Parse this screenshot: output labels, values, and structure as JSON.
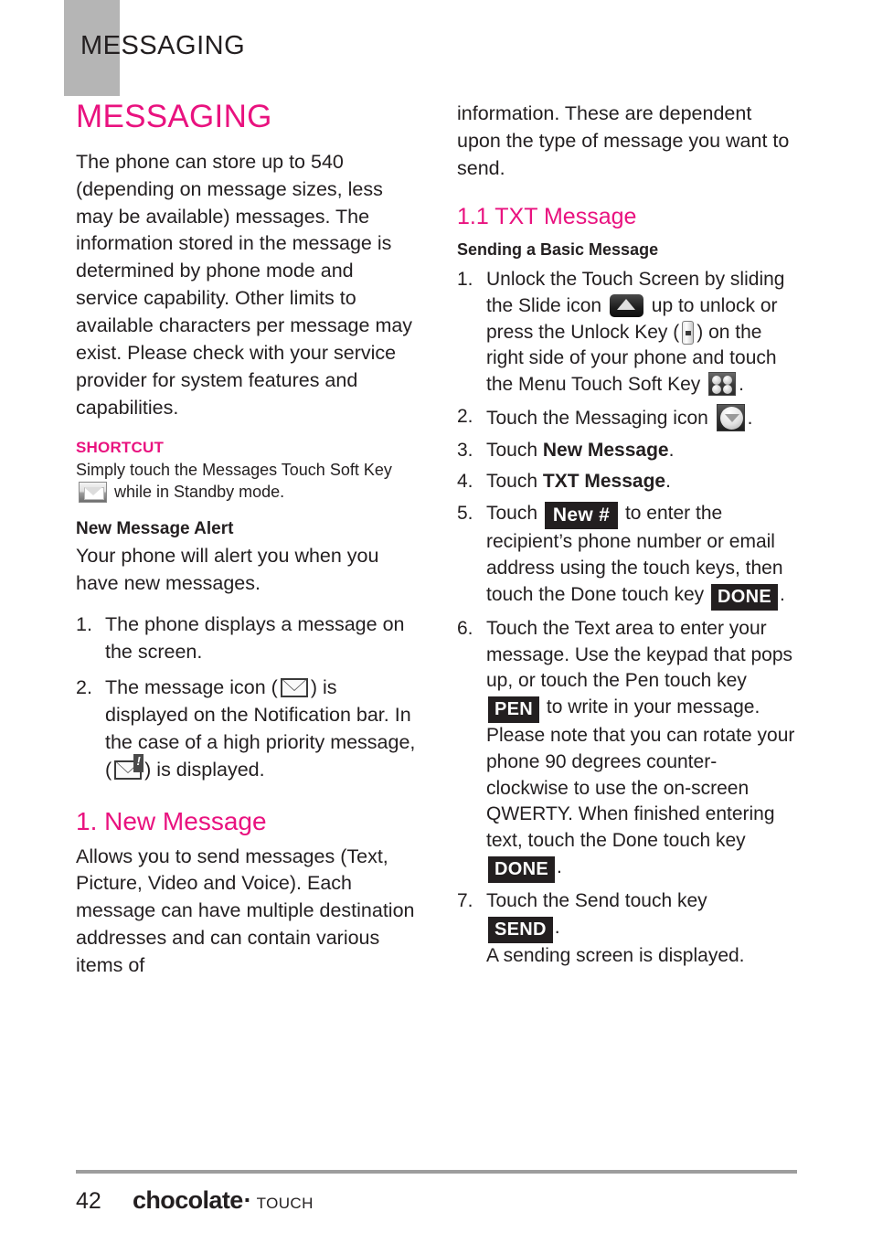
{
  "running_header": {
    "title": "MESSAGING"
  },
  "left_column": {
    "chapter_title": "MESSAGING",
    "intro_paragraph": "The phone can store up to 540 (depending on message sizes, less may be available) messages. The information stored in the message is determined by phone mode and service capability. Other limits to available characters per message may exist. Please check with your service provider for system features and capabilities.",
    "shortcut_label": "SHORTCUT",
    "shortcut_text_before": "Simply touch the Messages Touch Soft Key",
    "shortcut_icon": "messages-softkey-icon",
    "shortcut_text_after": "while in Standby mode.",
    "new_message_alert_heading": "New Message Alert",
    "new_message_alert_body": "Your phone will alert you when you have new messages.",
    "alert_steps": [
      {
        "num": "1.",
        "text": "The phone displays a message on the screen."
      },
      {
        "num": "2.",
        "text_a": "The message icon (",
        "icon_a": "envelope-icon",
        "text_b": ") is displayed on the Notification bar. In the case of a high priority message, (",
        "icon_b": "envelope-urgent-icon",
        "text_c": ") is displayed."
      }
    ],
    "section_title": "1. New Message",
    "section_body": "Allows you to send messages (Text, Picture, Video and Voice). Each message can have multiple destination addresses and can contain various items of"
  },
  "right_column": {
    "continued_paragraph": "information. These are dependent upon the type of message you want to send.",
    "subsection_title": "1.1 TXT Message",
    "subsection_heading": "Sending a Basic Message",
    "steps": [
      {
        "num": "1.",
        "text_a": "Unlock the Touch Screen by sliding the Slide icon",
        "icon_a": "slide-up-icon",
        "text_b": "up to unlock or press the Unlock Key (",
        "icon_b": "unlock-key-icon",
        "text_c": ") on the right side of your phone and touch the Menu Touch Soft Key",
        "icon_c": "menu-softkey-icon",
        "text_d": "."
      },
      {
        "num": "2.",
        "text_a": "Touch the Messaging icon",
        "icon_a": "messaging-app-icon",
        "text_b": "."
      },
      {
        "num": "3.",
        "text_a": "Touch ",
        "bold": "New Message",
        "text_b": "."
      },
      {
        "num": "4.",
        "text_a": "Touch ",
        "bold": "TXT Message",
        "text_b": "."
      },
      {
        "num": "5.",
        "text_a": "Touch",
        "chip_a": "New #",
        "text_b": "to enter the recipient’s phone number or email address using the touch keys, then touch the Done touch key",
        "chip_b": "DONE",
        "text_c": "."
      },
      {
        "num": "6.",
        "text_a": "Touch the Text area to enter your message. Use the keypad that pops up, or touch the Pen touch key",
        "chip_a": "PEN",
        "text_b": "to write in your message.  Please note that you can rotate your phone 90 degrees counter-clockwise to use the on-screen QWERTY. When finished entering text, touch the Done touch key",
        "chip_b": "DONE",
        "text_c": "."
      },
      {
        "num": "7.",
        "text_a": "Touch the Send touch key",
        "chip_a": "SEND",
        "text_b": ".",
        "text_c": "A sending screen is displayed."
      }
    ]
  },
  "footer": {
    "page_number": "42",
    "brand_name": "chocolate",
    "brand_dot": "·",
    "brand_suffix": "TOUCH"
  },
  "colors": {
    "accent_magenta": "#e9127f",
    "header_tab_gray": "#b5b5b5",
    "body_black": "#231f20",
    "rule_gray": "#9d9d9d"
  }
}
